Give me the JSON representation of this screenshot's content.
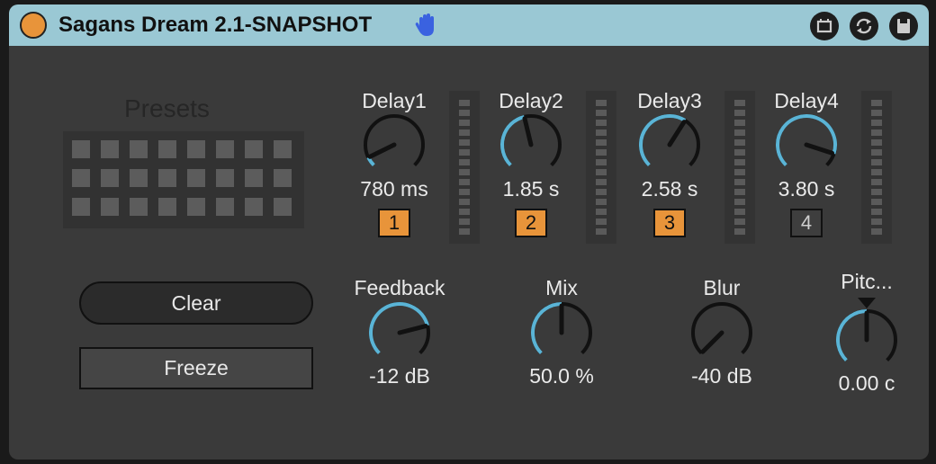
{
  "device": {
    "title": "Sagans Dream 2.1-SNAPSHOT",
    "icons": [
      "power-icon",
      "hand-icon",
      "pin-icon",
      "refresh-icon",
      "save-icon"
    ],
    "accent_color": "#e8943a",
    "knob_arc_color": "#5ab4d6"
  },
  "presets": {
    "title": "Presets",
    "rows": 3,
    "cols": 8
  },
  "buttons": {
    "clear": "Clear",
    "freeze": "Freeze"
  },
  "delays": [
    {
      "label": "Delay1",
      "value": "780 ms",
      "num": "1",
      "active": true,
      "level": 0.07
    },
    {
      "label": "Delay2",
      "value": "1.85 s",
      "num": "2",
      "active": true,
      "level": 0.45
    },
    {
      "label": "Delay3",
      "value": "2.58 s",
      "num": "3",
      "active": true,
      "level": 0.62
    },
    {
      "label": "Delay4",
      "value": "3.80 s",
      "num": "4",
      "active": false,
      "level": 0.9
    }
  ],
  "knobs": [
    {
      "label": "Feedback",
      "value": "-12 dB",
      "level": 0.78
    },
    {
      "label": "Mix",
      "value": "50.0 %",
      "level": 0.5
    },
    {
      "label": "Blur",
      "value": "-40 dB",
      "level": 0.0
    },
    {
      "label": "Pitc...",
      "value": "0.00 c",
      "level": 0.5
    }
  ]
}
